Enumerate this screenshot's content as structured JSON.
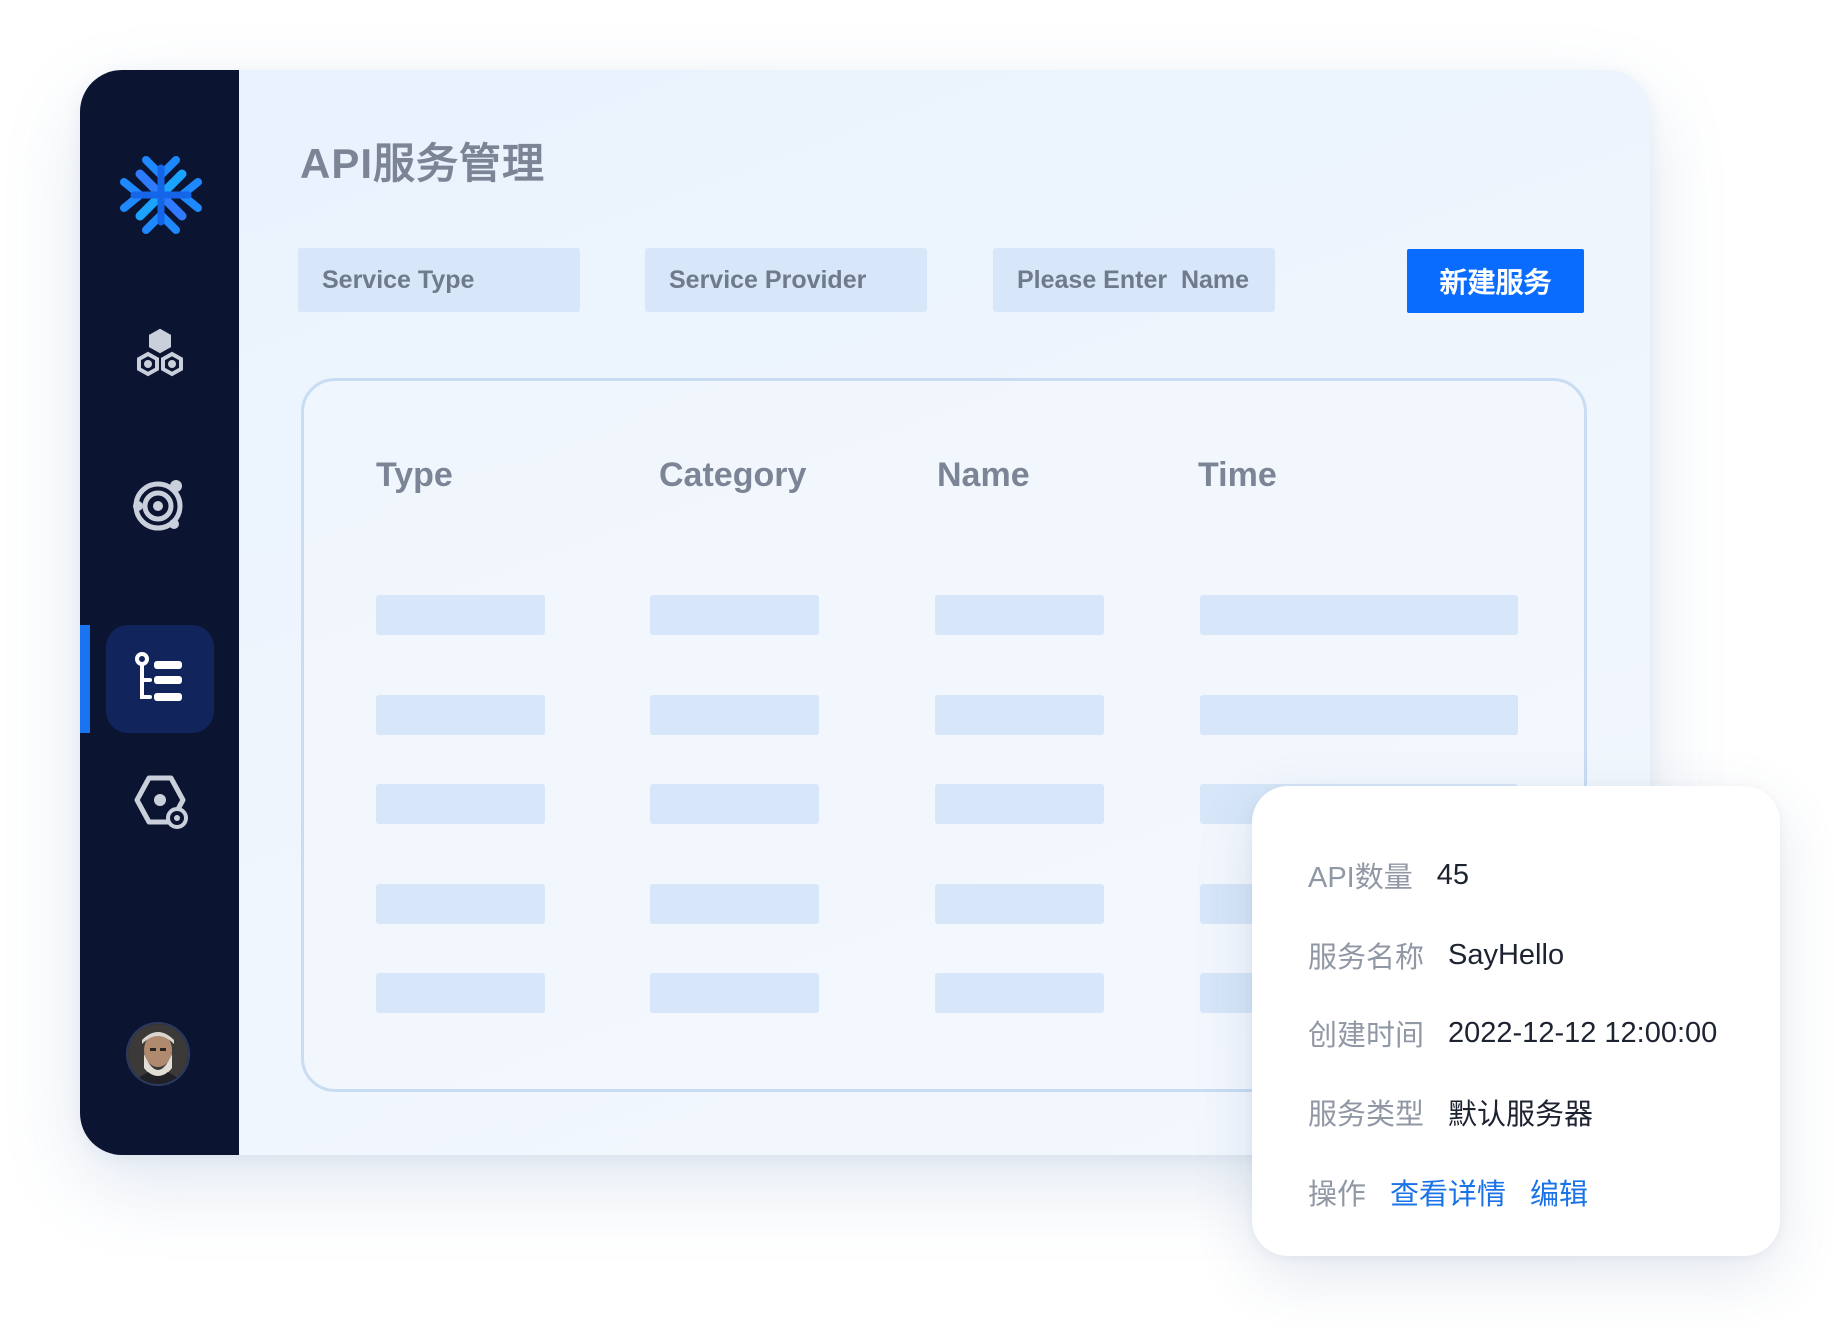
{
  "page": {
    "title": "API服务管理"
  },
  "filters": {
    "service_type_placeholder": "Service Type",
    "service_provider_placeholder": "Service Provider",
    "name_placeholder": "Please Enter  Name",
    "new_button_label": "新建服务"
  },
  "table": {
    "columns": [
      "Type",
      "Category",
      "Name",
      "Time"
    ],
    "row_count_placeholders": 5
  },
  "sidebar": {
    "items": [
      {
        "icon": "cluster-icon"
      },
      {
        "icon": "target-icon"
      },
      {
        "icon": "list-tree-icon",
        "active": true
      },
      {
        "icon": "service-settings-icon"
      }
    ],
    "accent_color": "#1a73f0",
    "background_color": "#0b1532"
  },
  "detail": {
    "api_count_label": "API数量",
    "api_count_value": "45",
    "service_name_label": "服务名称",
    "service_name_value": "SayHello",
    "created_time_label": "创建时间",
    "created_time_value": "2022-12-12 12:00:00",
    "service_type_label": "服务类型",
    "service_type_value": "默认服务器",
    "actions_label": "操作",
    "view_details_label": "查看详情",
    "edit_label": "编辑"
  },
  "colors": {
    "primary": "#0a6cff",
    "link": "#1a73e8"
  }
}
